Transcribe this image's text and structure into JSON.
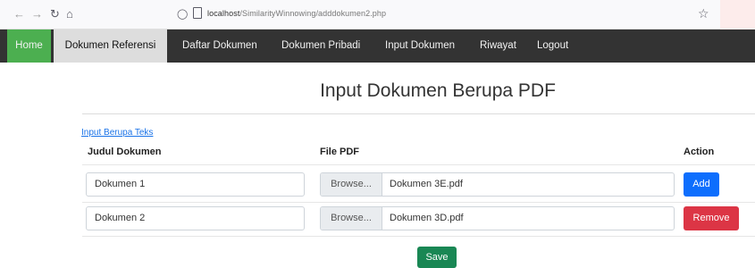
{
  "browser": {
    "url_host": "localhost",
    "url_path": "/SimilarityWinnowing/adddokumen2.php",
    "icons": [
      "back-arrow-icon",
      "forward-arrow-icon",
      "reload-icon",
      "home-icon",
      "shield-icon",
      "page-icon",
      "bookmark-star-icon"
    ]
  },
  "nav": {
    "items": [
      "Home",
      "Dokumen Referensi",
      "Daftar Dokumen",
      "Dokumen Pribadi",
      "Input Dokumen",
      "Riwayat",
      "Logout"
    ],
    "active_color": "#4caf50",
    "bar_color": "#333333"
  },
  "page": {
    "title": "Input Dokumen Berupa PDF",
    "text_link": "Input Berupa Teks"
  },
  "table": {
    "headers": [
      "Judul Dokumen",
      "File PDF",
      "Action"
    ],
    "rows": [
      {
        "title": "Dokumen 1",
        "browse": "Browse...",
        "file": "Dokumen 3E.pdf",
        "action": "Add"
      },
      {
        "title": "Dokumen 2",
        "browse": "Browse...",
        "file": "Dokumen 3D.pdf",
        "action": "Remove"
      }
    ]
  },
  "form": {
    "save": "Save"
  }
}
